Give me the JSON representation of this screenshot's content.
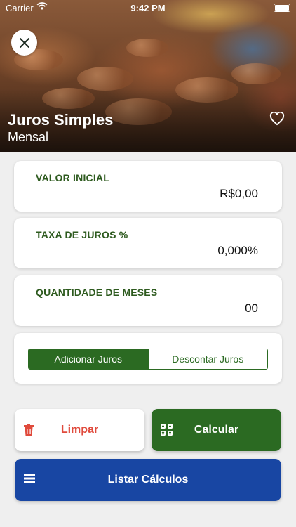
{
  "status_bar": {
    "carrier": "Carrier",
    "time": "9:42 PM"
  },
  "header": {
    "title": "Juros Simples",
    "subtitle": "Mensal"
  },
  "fields": [
    {
      "label": "VALOR INICIAL",
      "value": "R$0,00"
    },
    {
      "label": "TAXA DE JUROS %",
      "value": "0,000%"
    },
    {
      "label": "QUANTIDADE DE MESES",
      "value": "00"
    }
  ],
  "mode_toggle": {
    "options": [
      "Adicionar Juros",
      "Descontar Juros"
    ],
    "selected": "Adicionar Juros"
  },
  "actions": {
    "clear": "Limpar",
    "calculate": "Calcular",
    "list": "Listar Cálculos"
  },
  "colors": {
    "primary_green": "#2b6a22",
    "danger_red": "#e04a3c",
    "primary_blue": "#1846a3",
    "label_green": "#2d5a1e"
  },
  "icons": {
    "close": "close-icon",
    "favorite": "heart-icon",
    "clear": "trash-icon",
    "calculate": "calculator-icon",
    "list": "list-icon"
  }
}
